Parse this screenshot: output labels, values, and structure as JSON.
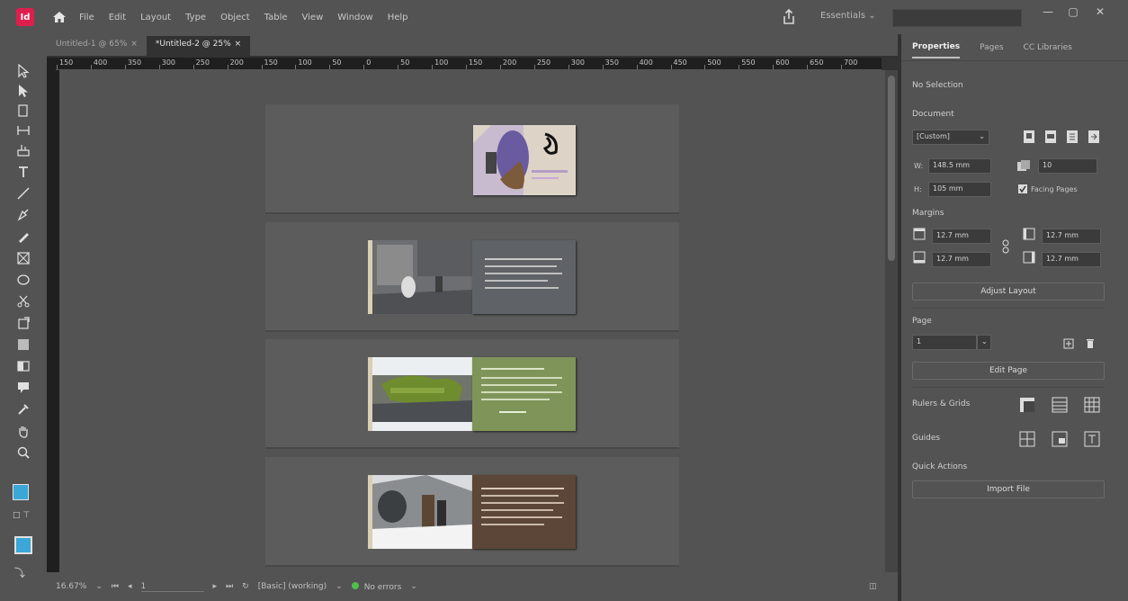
{
  "app": {
    "logo": "Id"
  },
  "menubar": {
    "items": [
      "File",
      "Edit",
      "Layout",
      "Type",
      "Object",
      "Table",
      "View",
      "Window",
      "Help"
    ],
    "workspace": "Essentials",
    "window_controls": {
      "minimize": "—",
      "restore": "▢",
      "close": "✕"
    }
  },
  "tabs": [
    {
      "label": "Untitled-1 @ 65%",
      "active": false
    },
    {
      "label": "*Untitled-2 @ 25%",
      "active": true
    }
  ],
  "ruler": {
    "ticks": [
      "150",
      "400",
      "350",
      "300",
      "250",
      "200",
      "150",
      "100",
      "50",
      "0",
      "50",
      "100",
      "150",
      "200",
      "250",
      "300",
      "350",
      "400",
      "450",
      "500",
      "550",
      "600",
      "650",
      "700"
    ]
  },
  "colors": {
    "accent": "#de1f4e",
    "fill_swatch": "#3aa7d6",
    "status_ok": "#4fbf4b"
  },
  "status": {
    "zoom": "16.67%",
    "page": "1",
    "style": "[Basic] (working)",
    "errors": "No errors"
  },
  "panel": {
    "tabs": [
      "Properties",
      "Pages",
      "CC Libraries"
    ],
    "selection": "No Selection",
    "document_heading": "Document",
    "preset": "[Custom]",
    "width_label": "W:",
    "width": "148.5 mm",
    "height_label": "H:",
    "height": "105 mm",
    "pages_count": "10",
    "facing_pages": "Facing Pages",
    "margins_heading": "Margins",
    "margin_top": "12.7 mm",
    "margin_bottom": "12.7 mm",
    "margin_left": "12.7 mm",
    "margin_right": "12.7 mm",
    "adjust_layout": "Adjust Layout",
    "page_heading": "Page",
    "page_value": "1",
    "edit_page": "Edit Page",
    "rulers_grids": "Rulers & Grids",
    "guides": "Guides",
    "quick_actions": "Quick Actions",
    "import_file": "Import File"
  }
}
